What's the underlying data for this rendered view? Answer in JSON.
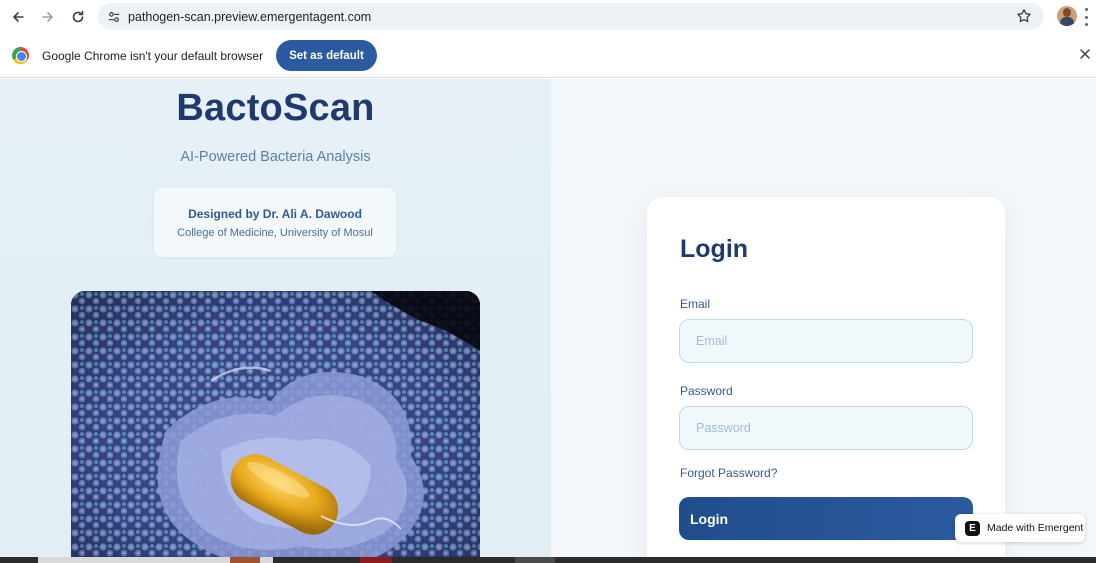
{
  "browser": {
    "url": "pathogen-scan.preview.emergentagent.com",
    "icons": {
      "back": "arrow-left-icon",
      "forward": "arrow-right-icon",
      "reload": "reload-icon",
      "site_settings": "tune-icon",
      "bookmark": "star-icon",
      "profile": "avatar",
      "menu": "kebab-icon"
    }
  },
  "infobar": {
    "message": "Google Chrome isn't your default browser",
    "button": "Set as default",
    "close_icon": "close-icon"
  },
  "hero": {
    "brand": "BactoScan",
    "tagline": "AI-Powered Bacteria Analysis",
    "designer": "Designed by Dr. Ali A. Dawood",
    "affiliation": "College of Medicine, University of Mosul"
  },
  "login": {
    "title": "Login",
    "email_label": "Email",
    "email_placeholder": "Email",
    "email_value": "",
    "password_label": "Password",
    "password_placeholder": "Password",
    "password_value": "",
    "forgot": "Forgot Password?",
    "submit": "Login"
  },
  "badge": {
    "text": "Made with Emergent",
    "logo": "E"
  },
  "colors": {
    "brand": "#1e3a6e",
    "accent": "#2c5aa0",
    "field_border": "#bfd9ea",
    "left_bg": "#e6f0f6"
  }
}
